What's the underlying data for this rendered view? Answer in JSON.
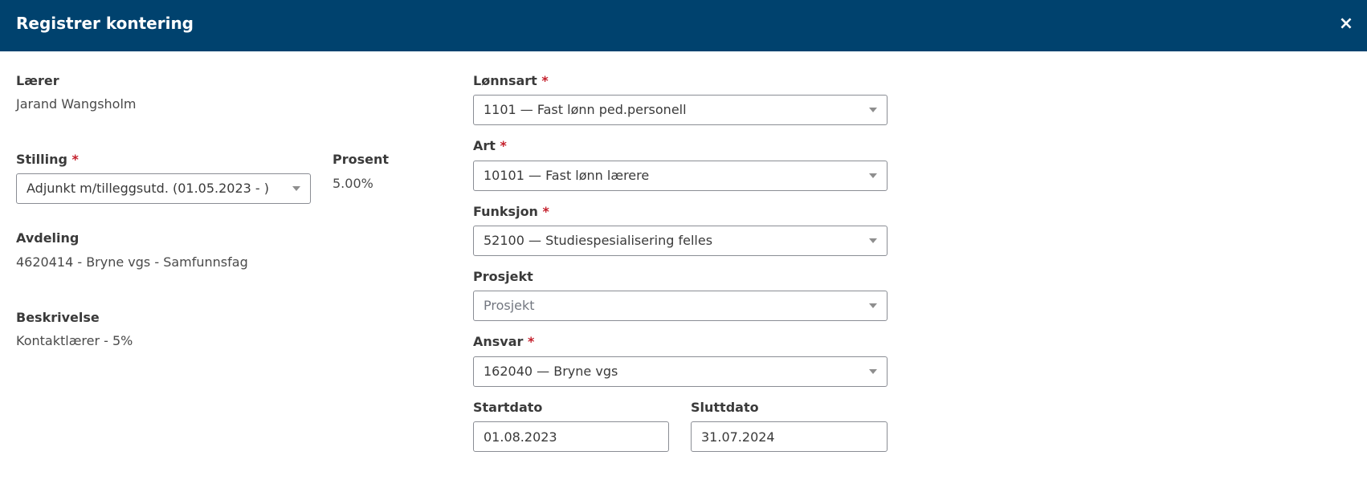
{
  "dialog": {
    "title": "Registrer kontering",
    "close_label": "×"
  },
  "left": {
    "teacher": {
      "label": "Lærer",
      "value": "Jarand Wangsholm"
    },
    "position": {
      "label": "Stilling",
      "required_mark": "*",
      "selected": "Adjunkt m/tilleggsutd. (01.05.2023 - )"
    },
    "percent": {
      "label": "Prosent",
      "value": "5.00%"
    },
    "department": {
      "label": "Avdeling",
      "value": "4620414 - Bryne vgs - Samfunnsfag"
    },
    "description": {
      "label": "Beskrivelse",
      "value": "Kontaktlærer - 5%"
    }
  },
  "right": {
    "salary_type": {
      "label": "Lønnsart",
      "required_mark": "*",
      "selected": "1101 — Fast lønn ped.personell"
    },
    "type": {
      "label": "Art",
      "required_mark": "*",
      "selected": "10101 — Fast lønn lærere"
    },
    "function": {
      "label": "Funksjon",
      "required_mark": "*",
      "selected": "52100 — Studiespesialisering felles"
    },
    "project": {
      "label": "Prosjekt",
      "placeholder": "Prosjekt"
    },
    "responsibility": {
      "label": "Ansvar",
      "required_mark": "*",
      "selected": "162040 — Bryne vgs"
    },
    "start_date": {
      "label": "Startdato",
      "value": "01.08.2023"
    },
    "end_date": {
      "label": "Sluttdato",
      "value": "31.07.2024"
    }
  },
  "colors": {
    "header_bg": "#00426e",
    "required": "#c41e2a"
  }
}
